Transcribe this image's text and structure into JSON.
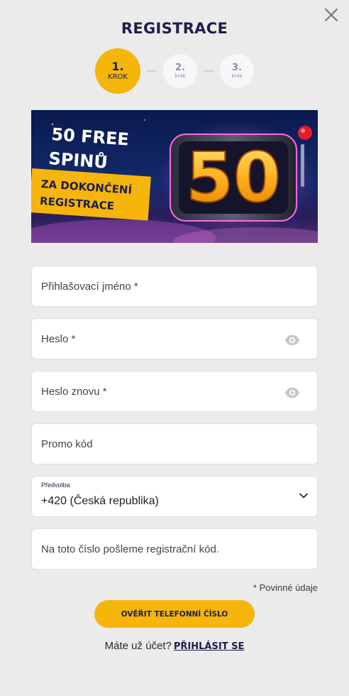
{
  "header": {
    "title": "REGISTRACE",
    "close_icon": "close-icon"
  },
  "steps": [
    {
      "number": "1.",
      "label": "KROK",
      "active": true
    },
    {
      "number": "2.",
      "label": "krok",
      "active": false
    },
    {
      "number": "3.",
      "label": "krok",
      "active": false
    }
  ],
  "banner": {
    "line1": "50 FREE",
    "line2": "SPINŮ",
    "line3": "ZA DOKONČENÍ",
    "line4": "REGISTRACE",
    "big_number": "50"
  },
  "form": {
    "username_placeholder": "Přihlašovací jméno *",
    "password_placeholder": "Heslo *",
    "password_repeat_placeholder": "Heslo znovu *",
    "promo_placeholder": "Promo kód",
    "prefix_label": "Předvolba",
    "prefix_value": "+420 (Česká republika)",
    "phone_placeholder": "Na toto číslo pošleme registrační kód.",
    "eye_icon": "eye-icon",
    "chevron_icon": "chevron-down-icon"
  },
  "footer": {
    "required_note": "* Povinné údaje",
    "verify_button": "OVĚŘIT TELEFONNÍ ČÍSLO",
    "have_account": "Máte už účet?",
    "login_link": "PŘIHLÁSIT SE"
  },
  "colors": {
    "accent": "#f5b50b",
    "navy": "#1c1f4a",
    "background": "#ebebeb"
  }
}
